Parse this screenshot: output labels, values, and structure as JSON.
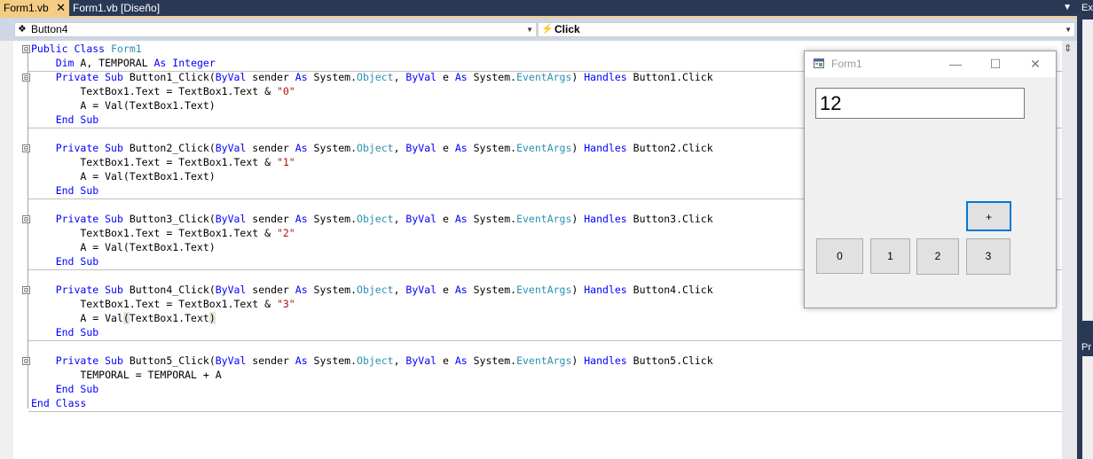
{
  "tabs": [
    {
      "label": "Form1.vb",
      "active": true
    },
    {
      "label": "Form1.vb [Diseño]",
      "active": false
    }
  ],
  "close_glyph": "✕",
  "right_panel": {
    "top_label": "Ex",
    "bottom_label": "Pr"
  },
  "navbar": {
    "object_combo": "Button4",
    "event_combo": "Click",
    "object_icon": "cube-icon",
    "event_icon": "lightning-icon"
  },
  "code_lines": [
    {
      "segments": [
        [
          "kw",
          "Public"
        ],
        [
          "t",
          " "
        ],
        [
          "kw",
          "Class"
        ],
        [
          "t",
          " "
        ],
        [
          "ty",
          "Form1"
        ]
      ]
    },
    {
      "segments": [
        [
          "t",
          "    "
        ],
        [
          "kw",
          "Dim"
        ],
        [
          "t",
          " A, TEMPORAL "
        ],
        [
          "kw",
          "As"
        ],
        [
          "t",
          " "
        ],
        [
          "kw",
          "Integer"
        ]
      ]
    },
    {
      "segments": [
        [
          "t",
          "    "
        ],
        [
          "kw",
          "Private"
        ],
        [
          "t",
          " "
        ],
        [
          "kw",
          "Sub"
        ],
        [
          "t",
          " Button1_Click("
        ],
        [
          "kw",
          "ByVal"
        ],
        [
          "t",
          " sender "
        ],
        [
          "kw",
          "As"
        ],
        [
          "t",
          " System."
        ],
        [
          "ty",
          "Object"
        ],
        [
          "t",
          ", "
        ],
        [
          "kw",
          "ByVal"
        ],
        [
          "t",
          " e "
        ],
        [
          "kw",
          "As"
        ],
        [
          "t",
          " System."
        ],
        [
          "ty",
          "EventArgs"
        ],
        [
          "t",
          ") "
        ],
        [
          "kw",
          "Handles"
        ],
        [
          "t",
          " Button1.Click"
        ]
      ]
    },
    {
      "segments": [
        [
          "t",
          "        TextBox1.Text = TextBox1.Text & "
        ],
        [
          "str",
          "\"0\""
        ]
      ]
    },
    {
      "segments": [
        [
          "t",
          "        A = Val(TextBox1.Text)"
        ]
      ]
    },
    {
      "segments": [
        [
          "t",
          "    "
        ],
        [
          "kw",
          "End"
        ],
        [
          "t",
          " "
        ],
        [
          "kw",
          "Sub"
        ]
      ]
    },
    {
      "segments": []
    },
    {
      "segments": [
        [
          "t",
          "    "
        ],
        [
          "kw",
          "Private"
        ],
        [
          "t",
          " "
        ],
        [
          "kw",
          "Sub"
        ],
        [
          "t",
          " Button2_Click("
        ],
        [
          "kw",
          "ByVal"
        ],
        [
          "t",
          " sender "
        ],
        [
          "kw",
          "As"
        ],
        [
          "t",
          " System."
        ],
        [
          "ty",
          "Object"
        ],
        [
          "t",
          ", "
        ],
        [
          "kw",
          "ByVal"
        ],
        [
          "t",
          " e "
        ],
        [
          "kw",
          "As"
        ],
        [
          "t",
          " System."
        ],
        [
          "ty",
          "EventArgs"
        ],
        [
          "t",
          ") "
        ],
        [
          "kw",
          "Handles"
        ],
        [
          "t",
          " Button2.Click"
        ]
      ]
    },
    {
      "segments": [
        [
          "t",
          "        TextBox1.Text = TextBox1.Text & "
        ],
        [
          "str",
          "\"1\""
        ]
      ]
    },
    {
      "segments": [
        [
          "t",
          "        A = Val(TextBox1.Text)"
        ]
      ]
    },
    {
      "segments": [
        [
          "t",
          "    "
        ],
        [
          "kw",
          "End"
        ],
        [
          "t",
          " "
        ],
        [
          "kw",
          "Sub"
        ]
      ]
    },
    {
      "segments": []
    },
    {
      "segments": [
        [
          "t",
          "    "
        ],
        [
          "kw",
          "Private"
        ],
        [
          "t",
          " "
        ],
        [
          "kw",
          "Sub"
        ],
        [
          "t",
          " Button3_Click("
        ],
        [
          "kw",
          "ByVal"
        ],
        [
          "t",
          " sender "
        ],
        [
          "kw",
          "As"
        ],
        [
          "t",
          " System."
        ],
        [
          "ty",
          "Object"
        ],
        [
          "t",
          ", "
        ],
        [
          "kw",
          "ByVal"
        ],
        [
          "t",
          " e "
        ],
        [
          "kw",
          "As"
        ],
        [
          "t",
          " System."
        ],
        [
          "ty",
          "EventArgs"
        ],
        [
          "t",
          ") "
        ],
        [
          "kw",
          "Handles"
        ],
        [
          "t",
          " Button3.Click"
        ]
      ]
    },
    {
      "segments": [
        [
          "t",
          "        TextBox1.Text = TextBox1.Text & "
        ],
        [
          "str",
          "\"2\""
        ]
      ]
    },
    {
      "segments": [
        [
          "t",
          "        A = Val(TextBox1.Text)"
        ]
      ]
    },
    {
      "segments": [
        [
          "t",
          "    "
        ],
        [
          "kw",
          "End"
        ],
        [
          "t",
          " "
        ],
        [
          "kw",
          "Sub"
        ]
      ]
    },
    {
      "segments": []
    },
    {
      "segments": [
        [
          "t",
          "    "
        ],
        [
          "kw",
          "Private"
        ],
        [
          "t",
          " "
        ],
        [
          "kw",
          "Sub"
        ],
        [
          "t",
          " Button4_Click("
        ],
        [
          "kw",
          "ByVal"
        ],
        [
          "t",
          " sender "
        ],
        [
          "kw",
          "As"
        ],
        [
          "t",
          " System."
        ],
        [
          "ty",
          "Object"
        ],
        [
          "t",
          ", "
        ],
        [
          "kw",
          "ByVal"
        ],
        [
          "t",
          " e "
        ],
        [
          "kw",
          "As"
        ],
        [
          "t",
          " System."
        ],
        [
          "ty",
          "EventArgs"
        ],
        [
          "t",
          ") "
        ],
        [
          "kw",
          "Handles"
        ],
        [
          "t",
          " Button4.Click"
        ]
      ]
    },
    {
      "segments": [
        [
          "t",
          "        TextBox1.Text = TextBox1.Text & "
        ],
        [
          "str",
          "\"3\""
        ]
      ]
    },
    {
      "segments": [
        [
          "t",
          "        A = Val"
        ],
        [
          "hl",
          "("
        ],
        [
          "t",
          "TextBox1.Text"
        ],
        [
          "hl",
          ")"
        ]
      ]
    },
    {
      "segments": [
        [
          "t",
          "    "
        ],
        [
          "kw",
          "End"
        ],
        [
          "t",
          " "
        ],
        [
          "kw",
          "Sub"
        ]
      ]
    },
    {
      "segments": []
    },
    {
      "segments": [
        [
          "t",
          "    "
        ],
        [
          "kw",
          "Private"
        ],
        [
          "t",
          " "
        ],
        [
          "kw",
          "Sub"
        ],
        [
          "t",
          " Button5_Click("
        ],
        [
          "kw",
          "ByVal"
        ],
        [
          "t",
          " sender "
        ],
        [
          "kw",
          "As"
        ],
        [
          "t",
          " System."
        ],
        [
          "ty",
          "Object"
        ],
        [
          "t",
          ", "
        ],
        [
          "kw",
          "ByVal"
        ],
        [
          "t",
          " e "
        ],
        [
          "kw",
          "As"
        ],
        [
          "t",
          " System."
        ],
        [
          "ty",
          "EventArgs"
        ],
        [
          "t",
          ") "
        ],
        [
          "kw",
          "Handles"
        ],
        [
          "t",
          " Button5.Click"
        ]
      ]
    },
    {
      "segments": [
        [
          "t",
          "        TEMPORAL = TEMPORAL + A"
        ]
      ]
    },
    {
      "segments": [
        [
          "t",
          "    "
        ],
        [
          "kw",
          "End"
        ],
        [
          "t",
          " "
        ],
        [
          "kw",
          "Sub"
        ]
      ]
    },
    {
      "segments": [
        [
          "kw",
          "End"
        ],
        [
          "t",
          " "
        ],
        [
          "kw",
          "Class"
        ]
      ]
    }
  ],
  "fold_markers": [
    "⊟",
    "⊟",
    "⊟",
    "⊟",
    "⊟",
    "⊟"
  ],
  "form": {
    "title": "Form1",
    "icon": "form-icon",
    "textbox_value": "12",
    "buttons": {
      "plus": "+",
      "b0": "0",
      "b1": "1",
      "b2": "2",
      "b3": "3"
    },
    "window_buttons": {
      "minimize": "—",
      "maximize": "☐",
      "close": "✕"
    }
  },
  "colors": {
    "keyword": "#0000ff",
    "type": "#2b91af",
    "string": "#a31515",
    "tab_active": "#f5cc84",
    "chrome_dark": "#293955"
  }
}
